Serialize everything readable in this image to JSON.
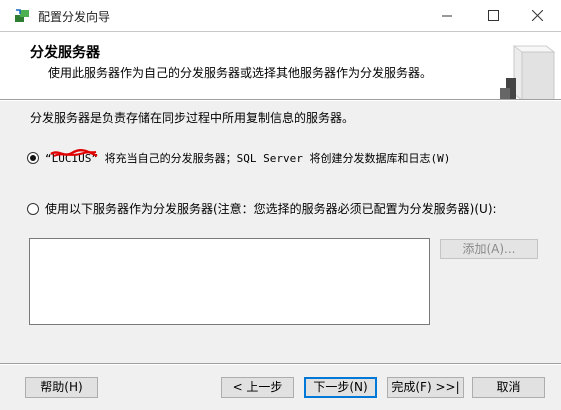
{
  "window": {
    "title": "配置分发向导",
    "icons": {
      "app": "wizard-app-icon",
      "minimize": "minimize-icon",
      "maximize": "maximize-icon",
      "close": "close-icon"
    }
  },
  "header": {
    "title": "分发服务器",
    "subtitle": "使用此服务器作为自己的分发服务器或选择其他服务器作为分发服务器。"
  },
  "body": {
    "intro": "分发服务器是负责存储在同步过程中所用复制信息的服务器。",
    "options": [
      {
        "label": "“LUCIUS” 将充当自己的分发服务器；SQL Server 将创建分发数据库和日志(W)",
        "selected": true
      },
      {
        "label": "使用以下服务器作为分发服务器(注意：您选择的服务器必须已配置为分发服务器)(U):",
        "selected": false
      }
    ],
    "add_button": "添加(A)..."
  },
  "footer": {
    "help": "帮助(H)",
    "prev": "< 上一步",
    "next": "下一步(N)",
    "finish": "完成(F) >>|",
    "cancel": "取消"
  }
}
